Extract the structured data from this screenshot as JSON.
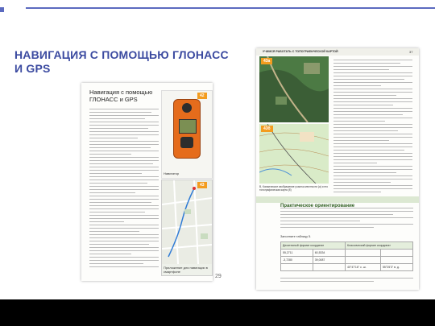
{
  "slide": {
    "title": "НАВИГАЦИЯ С ПОМОЩЬЮ ГЛОНАСС И GPS",
    "page_number": "29",
    "accent": "#5b6abf"
  },
  "left_page": {
    "heading": "Навигация с помощью ГЛОНАСС и GPS",
    "badge_top": "42",
    "badge_bottom": "43",
    "device_caption": "Навигатор",
    "map_caption": "Приложение для навигации в смартфоне"
  },
  "right_page": {
    "header": "УЧИМСЯ РАБОТАТЬ С ТОПОГРАФИЧЕСКОЙ КАРТОЙ",
    "header_page": "37",
    "badge_a": "43а",
    "badge_b": "43б",
    "photo_caption": "В, Космическое изображение участка местности (а) и его топографическая карта (б)",
    "section": "Практическое ориентирование",
    "task": "Заполните таблицу 5.",
    "table": {
      "headers": [
        "Десятичный формат координат",
        "Классический формат координат"
      ],
      "rows": [
        [
          "55,2711",
          "60,5334",
          "",
          ""
        ],
        [
          "-3,7280",
          "39,0087",
          "",
          ""
        ],
        [
          "",
          "",
          "40°47'16'' с. ш.",
          "55°25'3'' в. д."
        ]
      ]
    }
  }
}
